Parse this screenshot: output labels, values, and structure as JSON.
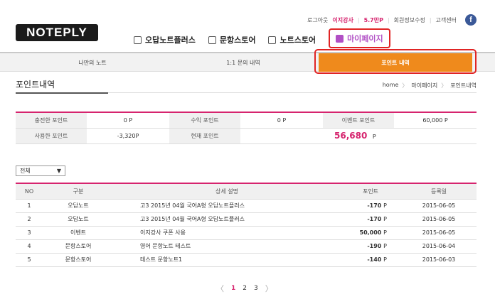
{
  "header": {
    "logo": "NOTEPLY",
    "util": {
      "logout": "로그아웃",
      "user": "이지강사",
      "points": "5.7만P",
      "member_edit": "회원정보수정",
      "support": "고객센터"
    },
    "facebook_glyph": "f",
    "gnb": [
      {
        "label": "오답노트플러스",
        "icon": "note-icon"
      },
      {
        "label": "문항스토어",
        "icon": "checklist-icon"
      },
      {
        "label": "노트스토어",
        "icon": "cart-icon"
      },
      {
        "label": "마이페이지",
        "icon": "mypage-icon"
      }
    ]
  },
  "subnav": [
    {
      "label": "나만의 노트"
    },
    {
      "label": "1:1 문의 내역"
    },
    {
      "label": "포인트 내역"
    }
  ],
  "page": {
    "title": "포인트내역",
    "breadcrumb": [
      "home",
      "마이페이지",
      "포인트내역"
    ]
  },
  "summary": {
    "charged_label": "충전한 포인트",
    "charged_value": "0 P",
    "earned_label": "수익 포인트",
    "earned_value": "0 P",
    "event_label": "이벤트 포인트",
    "event_value": "60,000 P",
    "used_label": "사용한 포인트",
    "used_value": "-3,320P",
    "current_label": "현재 포인트",
    "current_value": "56,680",
    "current_unit": "P"
  },
  "filter": {
    "selected": "전체",
    "caret": "▼"
  },
  "table": {
    "headers": [
      "NO",
      "구분",
      "상세 설명",
      "포인트",
      "등록일"
    ],
    "rows": [
      {
        "no": "1",
        "type": "오답노트",
        "desc": "고3 2015년 04월 국어A형 오답노트플러스",
        "points": "-170",
        "unit": "P",
        "date": "2015-06-05"
      },
      {
        "no": "2",
        "type": "오답노트",
        "desc": "고3 2015년 04월 국어A형 오답노트플러스",
        "points": "-170",
        "unit": "P",
        "date": "2015-06-05"
      },
      {
        "no": "3",
        "type": "이벤트",
        "desc": "이지강사 쿠폰 사용",
        "points": "50,000",
        "unit": "P",
        "date": "2015-06-05"
      },
      {
        "no": "4",
        "type": "문항스토어",
        "desc": "영어 문항노트 테스트",
        "points": "-190",
        "unit": "P",
        "date": "2015-06-04"
      },
      {
        "no": "5",
        "type": "문항스토어",
        "desc": "테스트 문항노트1",
        "points": "-140",
        "unit": "P",
        "date": "2015-06-03"
      }
    ]
  },
  "pagination": {
    "prev": "〈",
    "pages": [
      "1",
      "2",
      "3"
    ],
    "next": "〉",
    "current": "1"
  }
}
